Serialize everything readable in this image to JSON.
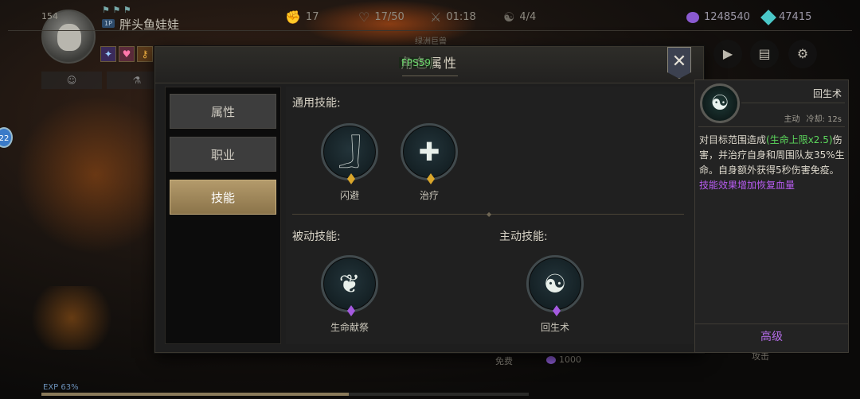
{
  "player": {
    "level": "154",
    "name": "胖头鱼娃娃",
    "tag": "1P"
  },
  "hud": {
    "stat1": "17",
    "hp": "17/50",
    "timer": "01:18",
    "party": "4/4",
    "currency_purple": "1248540",
    "currency_cyan": "47415",
    "left_badge": "22",
    "exp_label": "EXP 63%",
    "exp_progress": 0.63,
    "free_label": "免费",
    "cost_value": "1000",
    "attack_label": "攻击"
  },
  "dialog": {
    "title": "角色属性",
    "fps": "FPS59",
    "crest_label": "绿洲巨兽",
    "close": "✕",
    "tabs": [
      "属性",
      "职业",
      "技能"
    ],
    "active_tab": 2,
    "sections": {
      "common": "通用技能:",
      "passive": "被动技能:",
      "active": "主动技能:"
    },
    "skills": {
      "dodge": "闪避",
      "heal": "治疗",
      "sacrifice": "生命献祭",
      "revive": "回生术"
    }
  },
  "detail": {
    "name": "回生术",
    "type": "主动",
    "cooldown": "冷却: 12s",
    "desc_1": "对目标范围造成",
    "desc_hl": "(生命上限x2.5)",
    "desc_2": "伤害，并治疗自身和周围队友35%生命。自身额外获得5秒伤害免疫。",
    "desc_effect": "技能效果增加恢复血量",
    "upgrade": "高级"
  }
}
